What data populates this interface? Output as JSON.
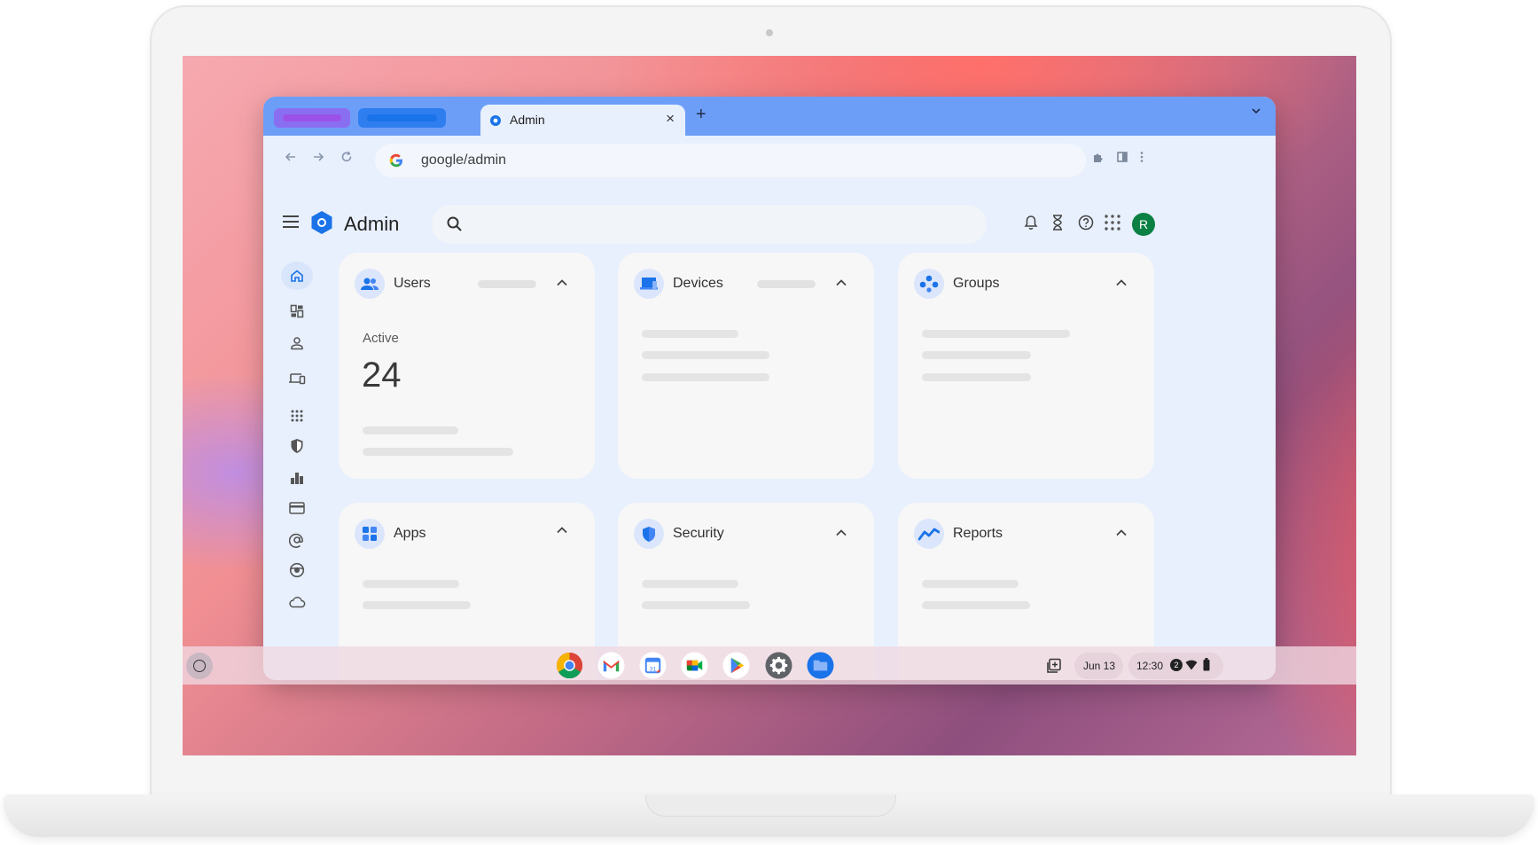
{
  "browser": {
    "active_tab_title": "Admin",
    "new_tab_symbol": "+",
    "close_symbol": "×",
    "url": "google/admin",
    "tab_pill_colors": [
      "#9b51e8",
      "#1a73e8"
    ]
  },
  "admin": {
    "title": "Admin",
    "avatar_letter": "R",
    "header_icons": [
      "bell-icon",
      "hourglass-icon",
      "help-icon",
      "apps-grid-icon"
    ],
    "nav_rail": [
      "home-icon",
      "dashboard-icon",
      "person-icon",
      "devices-icon",
      "apps-icon",
      "shield-icon",
      "bar-chart-icon",
      "billing-card-icon",
      "at-sign-icon",
      "support-icon",
      "cloud-icon"
    ]
  },
  "cards": {
    "users": {
      "title": "Users",
      "stat_label": "Active",
      "stat_value": "24"
    },
    "devices": {
      "title": "Devices"
    },
    "groups": {
      "title": "Groups"
    },
    "apps": {
      "title": "Apps"
    },
    "security": {
      "title": "Security"
    },
    "reports": {
      "title": "Reports"
    }
  },
  "shelf": {
    "apps": [
      "chrome",
      "gmail",
      "calendar",
      "meet",
      "play-store",
      "settings",
      "files"
    ],
    "calendar_day": "31",
    "date": "Jun 13",
    "time": "12:30",
    "notification_count": "2"
  },
  "colors": {
    "accent": "#1a73e8",
    "tabstrip": "#6d9ef7",
    "page_bg": "#e8f0fd",
    "avatar": "#0b8043"
  }
}
